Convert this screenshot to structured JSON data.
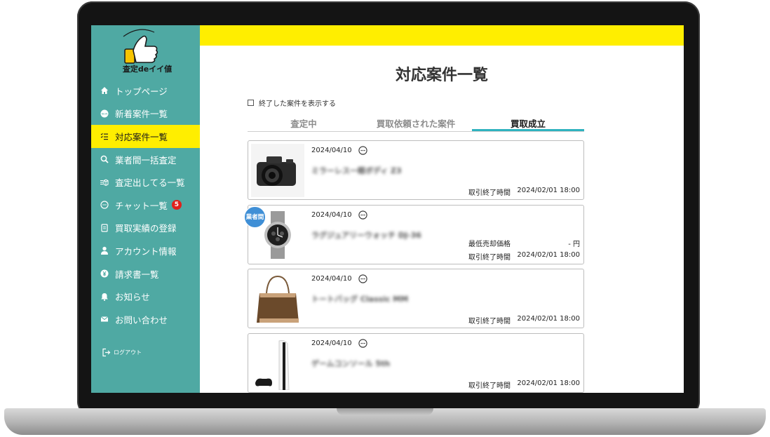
{
  "sidebar": {
    "logo_text": "査定deイイ値",
    "items": [
      {
        "label": "トップページ",
        "icon": "home-icon"
      },
      {
        "label": "新着案件一覧",
        "icon": "new-icon"
      },
      {
        "label": "対応案件一覧",
        "icon": "list-check-icon",
        "active": true
      },
      {
        "label": "業者間一括査定",
        "icon": "search-icon"
      },
      {
        "label": "査定出してる一覧",
        "icon": "box-list-icon"
      },
      {
        "label": "チャット一覧",
        "icon": "chat-icon",
        "badge": "5"
      },
      {
        "label": "買取実績の登録",
        "icon": "document-icon"
      },
      {
        "label": "アカウント情報",
        "icon": "user-icon"
      },
      {
        "label": "請求書一覧",
        "icon": "yen-icon"
      },
      {
        "label": "お知らせ",
        "icon": "bell-icon"
      },
      {
        "label": "お問い合わせ",
        "icon": "mail-icon"
      }
    ],
    "logout_label": "ログアウト"
  },
  "main": {
    "title": "対応案件一覧",
    "show_finished_label": "終了した案件を表示する",
    "tabs": [
      {
        "label": "査定中"
      },
      {
        "label": "買取依頼された案件"
      },
      {
        "label": "買取成立",
        "active": true
      }
    ],
    "cards": [
      {
        "date": "2024/04/10",
        "name": "ミラーレス一眼ボディ Z3",
        "thumb": "camera",
        "trader_badge": "",
        "min_price_label": "",
        "min_price_value": "",
        "end_label": "取引終了時間",
        "end_value": "2024/02/01 18:00"
      },
      {
        "date": "2024/04/10",
        "name": "ラグジュアリーウォッチ DJ-36",
        "thumb": "watch",
        "trader_badge": "業者間",
        "min_price_label": "最低売却価格",
        "min_price_value": "- 円",
        "end_label": "取引終了時間",
        "end_value": "2024/02/01 18:00"
      },
      {
        "date": "2024/04/10",
        "name": "トートバッグ Classic MM",
        "thumb": "bag",
        "trader_badge": "",
        "min_price_label": "",
        "min_price_value": "",
        "end_label": "取引終了時間",
        "end_value": "2024/02/01 18:00"
      },
      {
        "date": "2024/04/10",
        "name": "ゲームコンソール 5th",
        "thumb": "console",
        "trader_badge": "",
        "min_price_label": "",
        "min_price_value": "",
        "end_label": "取引終了時間",
        "end_value": "2024/02/01 18:00"
      }
    ]
  },
  "colors": {
    "sidebar_bg": "#4fa9a3",
    "accent_yellow": "#ffee00",
    "tab_underline": "#2fb3bf",
    "badge_red": "#e0201b",
    "trader_badge_blue": "#3f8fd6"
  }
}
